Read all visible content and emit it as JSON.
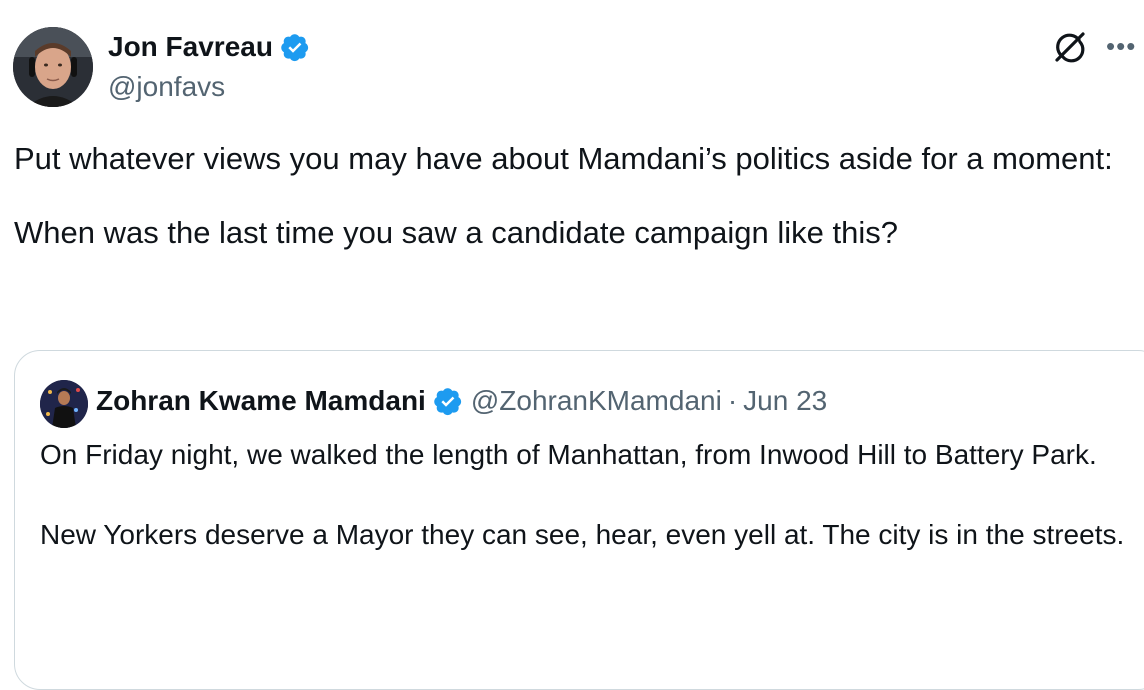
{
  "tweet": {
    "author": {
      "name": "Jon Favreau",
      "handle": "@jonfavs",
      "verified_color": "#1d9bf0"
    },
    "text": "Put whatever views you may have about Mamdani’s politics aside for a moment:\n\nWhen was the last time you saw a candidate campaign like this?",
    "icons": {
      "grok": "grok-icon",
      "more": "more-icon"
    },
    "quoted": {
      "author": {
        "name": "Zohran Kwame Mamdani",
        "handle": "@ZohranKMamdani"
      },
      "separator": "·",
      "date": "Jun 23",
      "text": "On Friday night, we walked the length of Manhattan, from Inwood Hill to Battery Park.\n\nNew Yorkers deserve a Mayor they can see, hear, even yell at. The city is in the streets."
    }
  },
  "colors": {
    "text": "#0f1419",
    "secondary": "#536471",
    "border": "#cfd9de",
    "verified": "#1d9bf0"
  }
}
